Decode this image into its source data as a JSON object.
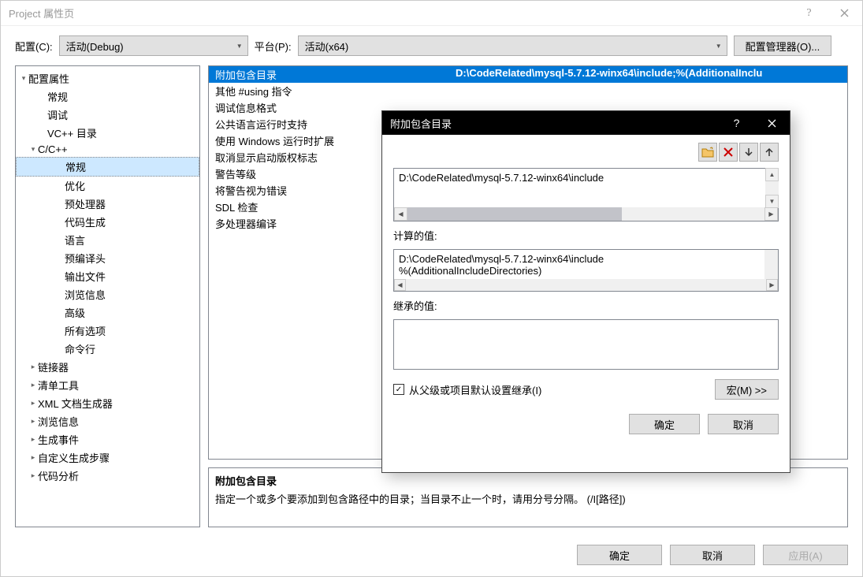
{
  "window": {
    "title": "Project 属性页"
  },
  "toolbar": {
    "config_label": "配置(C):",
    "config_value": "活动(Debug)",
    "platform_label": "平台(P):",
    "platform_value": "活动(x64)",
    "manager_btn": "配置管理器(O)..."
  },
  "tree": [
    {
      "label": "配置属性",
      "indent": 0,
      "expand": "▾"
    },
    {
      "label": "常规",
      "indent": 1
    },
    {
      "label": "调试",
      "indent": 1
    },
    {
      "label": "VC++ 目录",
      "indent": 1
    },
    {
      "label": "C/C++",
      "indent": "1b",
      "expand": "▾"
    },
    {
      "label": "常规",
      "indent": 2,
      "sel": true
    },
    {
      "label": "优化",
      "indent": 2
    },
    {
      "label": "预处理器",
      "indent": 2
    },
    {
      "label": "代码生成",
      "indent": 2
    },
    {
      "label": "语言",
      "indent": 2
    },
    {
      "label": "预编译头",
      "indent": 2
    },
    {
      "label": "输出文件",
      "indent": 2
    },
    {
      "label": "浏览信息",
      "indent": 2
    },
    {
      "label": "高级",
      "indent": 2
    },
    {
      "label": "所有选项",
      "indent": 2
    },
    {
      "label": "命令行",
      "indent": 2
    },
    {
      "label": "链接器",
      "indent": "1b",
      "expand": "▸"
    },
    {
      "label": "清单工具",
      "indent": "1b",
      "expand": "▸"
    },
    {
      "label": "XML 文档生成器",
      "indent": "1b",
      "expand": "▸"
    },
    {
      "label": "浏览信息",
      "indent": "1b",
      "expand": "▸"
    },
    {
      "label": "生成事件",
      "indent": "1b",
      "expand": "▸"
    },
    {
      "label": "自定义生成步骤",
      "indent": "1b",
      "expand": "▸"
    },
    {
      "label": "代码分析",
      "indent": "1b",
      "expand": "▸"
    }
  ],
  "props": [
    {
      "label": "附加包含目录",
      "value": "D:\\CodeRelated\\mysql-5.7.12-winx64\\include;%(AdditionalInclu",
      "sel": true
    },
    {
      "label": "其他 #using 指令",
      "value": ""
    },
    {
      "label": "调试信息格式",
      "value": ""
    },
    {
      "label": "公共语言运行时支持",
      "value": ""
    },
    {
      "label": "使用 Windows 运行时扩展",
      "value": ""
    },
    {
      "label": "取消显示启动版权标志",
      "value": ""
    },
    {
      "label": "警告等级",
      "value": ""
    },
    {
      "label": "将警告视为错误",
      "value": ""
    },
    {
      "label": "SDL 检查",
      "value": ""
    },
    {
      "label": "多处理器编译",
      "value": ""
    }
  ],
  "desc": {
    "title": "附加包含目录",
    "body": "指定一个或多个要添加到包含路径中的目录；当目录不止一个时，请用分号分隔。     (/I[路径])"
  },
  "footer": {
    "ok": "确定",
    "cancel": "取消",
    "apply": "应用(A)"
  },
  "popup": {
    "title": "附加包含目录",
    "entry": "D:\\CodeRelated\\mysql-5.7.12-winx64\\include",
    "computed_label": "计算的值:",
    "computed_lines": [
      "D:\\CodeRelated\\mysql-5.7.12-winx64\\include",
      "%(AdditionalIncludeDirectories)"
    ],
    "inherited_label": "继承的值:",
    "inherit_check": "从父级或项目默认设置继承(I)",
    "macro_btn": "宏(M) >>",
    "ok": "确定",
    "cancel": "取消",
    "icons": {
      "folder": "folder-icon",
      "delete": "delete-icon",
      "down": "arrow-down-icon",
      "up": "arrow-up-icon"
    }
  }
}
